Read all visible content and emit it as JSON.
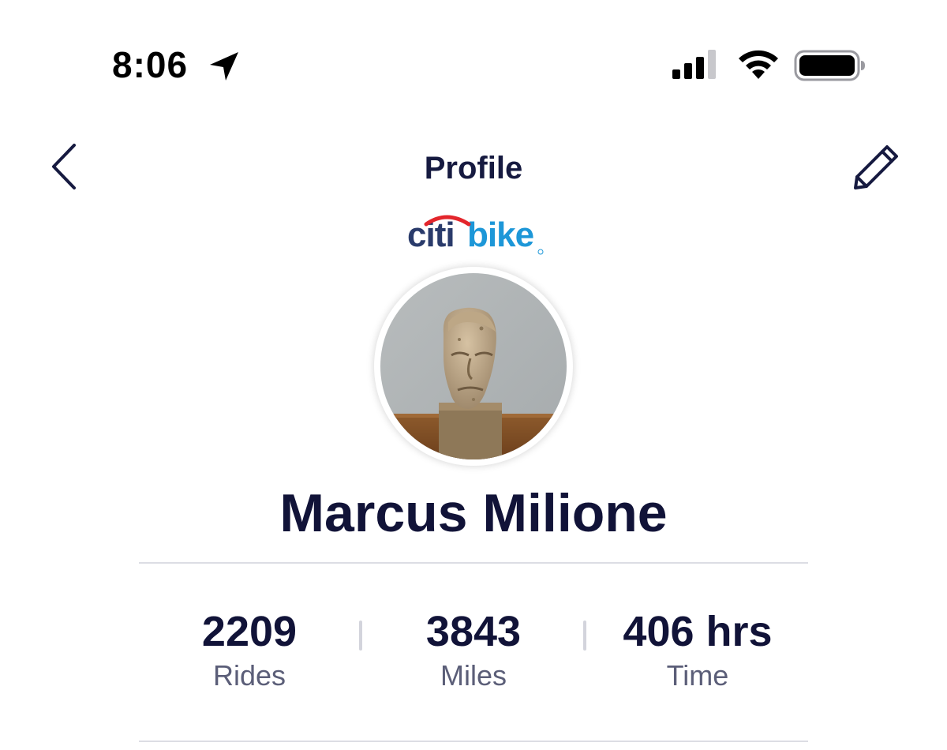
{
  "status_bar": {
    "time": "8:06",
    "icons": [
      "location-arrow-icon",
      "cellular-signal-icon",
      "wifi-icon",
      "battery-icon"
    ]
  },
  "nav": {
    "title": "Profile",
    "back_icon": "chevron-left-icon",
    "edit_icon": "pencil-icon"
  },
  "logo": {
    "part1": "citi",
    "part2": "bike",
    "colors": {
      "citi": "#2a3b6b",
      "bike": "#1d97d8",
      "arc": "#e3262c"
    }
  },
  "profile": {
    "name": "Marcus Milione",
    "avatar": "sculpted-head-photo"
  },
  "stats": [
    {
      "value": "2209",
      "label": "Rides"
    },
    {
      "value": "3843",
      "label": "Miles"
    },
    {
      "value": "406 hrs",
      "label": "Time"
    }
  ],
  "colors": {
    "text_primary": "#111338",
    "text_secondary": "#5b5e78",
    "divider": "#dcdde4"
  }
}
